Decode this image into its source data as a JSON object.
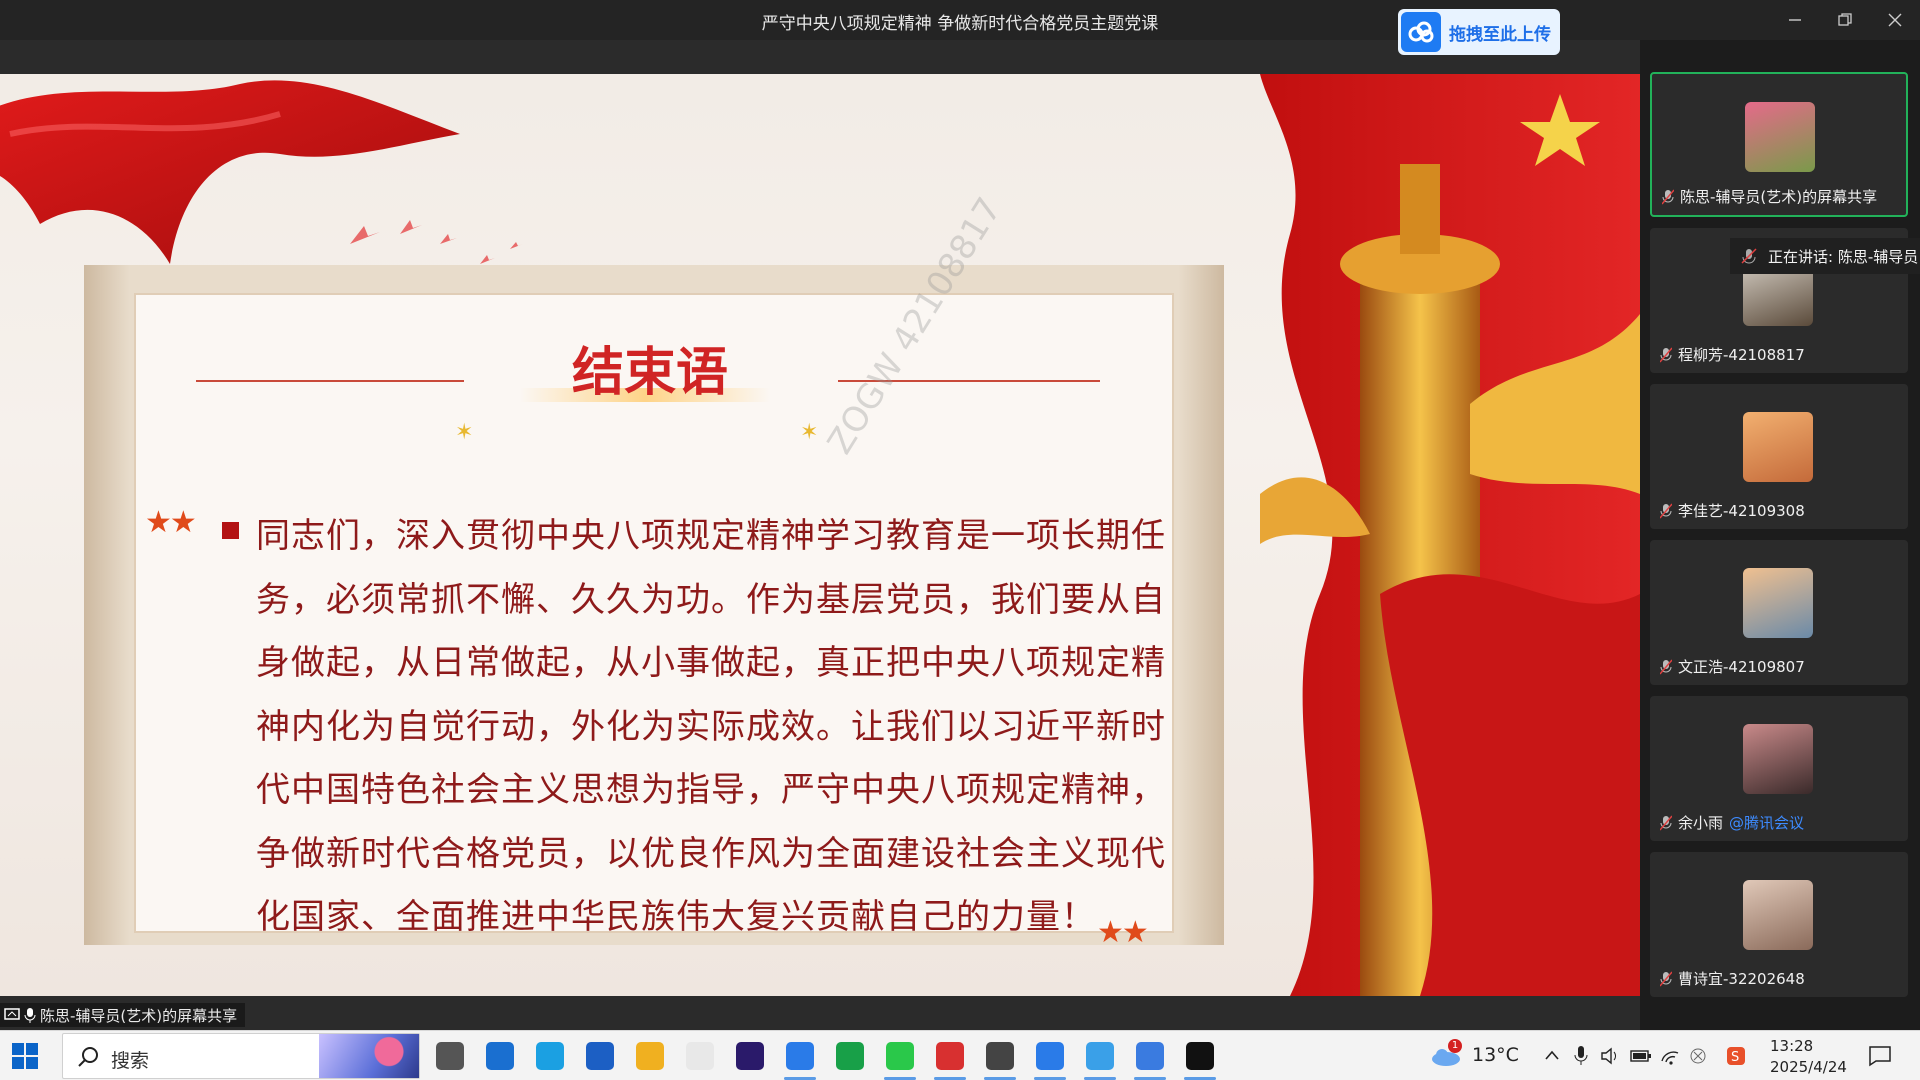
{
  "window": {
    "title": "严守中央八项规定精神 争做新时代合格党员主题党课",
    "upload_button": "拖拽至此上传"
  },
  "slide": {
    "title": "结束语",
    "body": "同志们，深入贯彻中央八项规定精神学习教育是一项长期任务，必须常抓不懈、久久为功。作为基层党员，我们要从自身做起，从日常做起，从小事做起，真正把中央八项规定精神内化为自觉行动，外化为实际成效。让我们以习近平新时代中国特色社会主义思想为指导，严守中央八项规定精神，争做新时代合格党员，以优良作风为全面建设社会主义现代化国家、全面推进中华民族伟大复兴贡献自己的力量！",
    "watermark": "ZOGW 42108817"
  },
  "share_label": "陈思-辅导员(艺术)的屏幕共享",
  "speaking_banner": "正在讲话: 陈思-辅导员",
  "participants": [
    {
      "name": "陈思-辅导员(艺术)的屏幕共享",
      "active": true,
      "colors": [
        "#e56a8a",
        "#7a9a4a"
      ]
    },
    {
      "name": "程柳芳-42108817",
      "active": false,
      "colors": [
        "#d9d2c8",
        "#5a4a3a"
      ]
    },
    {
      "name": "李佳艺-42109308",
      "active": false,
      "colors": [
        "#f2b070",
        "#c46a3a"
      ]
    },
    {
      "name": "文正浩-42109807",
      "active": false,
      "colors": [
        "#f0c090",
        "#6a8aa8"
      ]
    },
    {
      "name": "余小雨",
      "link": "@腾讯会议",
      "active": false,
      "colors": [
        "#c98a8a",
        "#3a2a2a"
      ]
    },
    {
      "name": "曹诗宜-32202648",
      "active": false,
      "colors": [
        "#e0c8b8",
        "#8a6a5a"
      ]
    }
  ],
  "taskbar": {
    "search_placeholder": "搜索",
    "weather": "13°C",
    "weather_badge": "1",
    "time": "13:28",
    "date": "2025/4/24",
    "apps": [
      "task-view-icon",
      "mail-icon",
      "edge-icon",
      "store-icon",
      "file-explorer-icon",
      "notepad-icon",
      "premiere-icon",
      "tencent-meeting-icon",
      "h-app-icon",
      "wechat-icon",
      "wps-icon",
      "network-app-icon",
      "tencent-meeting-icon-2",
      "qq-browser-icon",
      "screen-app-icon",
      "qq-icon"
    ]
  }
}
